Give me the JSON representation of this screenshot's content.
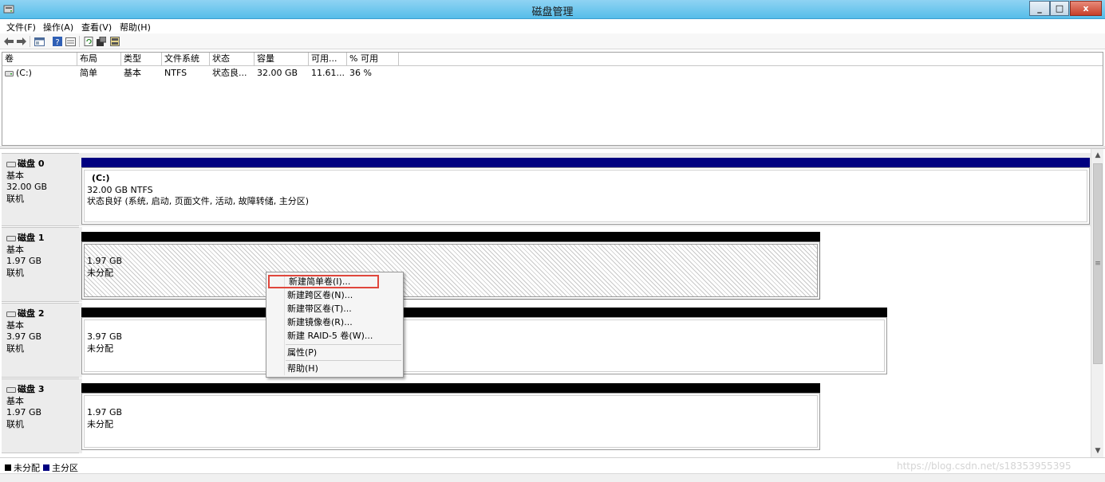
{
  "window": {
    "title": "磁盘管理",
    "min_label": "_",
    "max_label": "□",
    "close_label": "x"
  },
  "menubar": {
    "items": [
      "文件(F)",
      "操作(A)",
      "查看(V)",
      "帮助(H)"
    ]
  },
  "toolbar": {
    "buttons": [
      "back-icon",
      "forward-icon",
      "console-icon",
      "help-icon",
      "list-view-icon",
      "refresh-icon",
      "properties-icon",
      "rescan-icon"
    ]
  },
  "volume_list": {
    "columns": [
      "卷",
      "布局",
      "类型",
      "文件系统",
      "状态",
      "容量",
      "可用...",
      "% 可用"
    ],
    "rows": [
      {
        "volume": "(C:)",
        "layout": "简单",
        "type": "基本",
        "fs": "NTFS",
        "status": "状态良...",
        "capacity": "32.00 GB",
        "free": "11.61...",
        "pct_free": "36 %"
      }
    ]
  },
  "disks": [
    {
      "name": "磁盘 0",
      "type": "基本",
      "size": "32.00 GB",
      "state": "联机",
      "partition": {
        "label": "(C:)",
        "size_fs": "32.00 GB NTFS",
        "status": "状态良好 (系统, 启动, 页面文件, 活动, 故障转储, 主分区)"
      }
    },
    {
      "name": "磁盘 1",
      "type": "基本",
      "size": "1.97 GB",
      "state": "联机",
      "partition": {
        "size": "1.97 GB",
        "status": "未分配"
      }
    },
    {
      "name": "磁盘 2",
      "type": "基本",
      "size": "3.97 GB",
      "state": "联机",
      "partition": {
        "size": "3.97 GB",
        "status": "未分配"
      }
    },
    {
      "name": "磁盘 3",
      "type": "基本",
      "size": "1.97 GB",
      "state": "联机",
      "partition": {
        "size": "1.97 GB",
        "status": "未分配"
      }
    }
  ],
  "context_menu": {
    "items": [
      "新建简单卷(I)...",
      "新建跨区卷(N)...",
      "新建带区卷(T)...",
      "新建镜像卷(R)...",
      "新建 RAID-5 卷(W)...",
      "属性(P)",
      "帮助(H)"
    ],
    "highlighted_index": 0
  },
  "legend": {
    "unallocated": "未分配",
    "primary": "主分区"
  },
  "watermark": "https://blog.csdn.net/s18353955395",
  "colors": {
    "primary_partition": "#000080",
    "unallocated": "#000000",
    "highlight_border": "#e0463c"
  }
}
